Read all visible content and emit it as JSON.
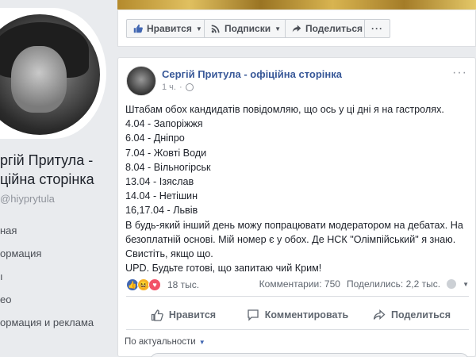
{
  "sidebar": {
    "page_name_line1": "ргій Притула -",
    "page_name_line2": "ційна сторінка",
    "handle": "hiyprytula",
    "nav_items": [
      "ная",
      "ормация",
      "ı",
      "ео",
      "ормация и реклама"
    ]
  },
  "actionbar": {
    "like_label": "Нравится",
    "follow_label": "Подписки",
    "share_label": "Поделиться",
    "more_label": "···"
  },
  "post": {
    "author": "Сергій Притула - офіційна сторінка",
    "time": "1 ч.",
    "more": "···",
    "body": "Штабам обох кандидатів повідомляю, що ось у ці дні я на гастролях.\n4.04 - Запоріжжя\n6.04 - Дніпро\n7.04 - Жовті Води\n8.04 - Вільногірськ\n13.04 - Ізяслав\n14.04 - Нетішин\n16,17.04 - Львів\nВ будь-який інший день можу попрацювати модератором на дебатах. На безоплатній основі. Мій номер є у обох. Де НСК \"Олімпійський\" я знаю. Свистіть, якщо що.\nUPD. Будьте готові, що запитаю чий Крим!",
    "reactions_count": "18 тыс.",
    "comments_count": "Комментарии: 750",
    "shares_count": "Поделились: 2,2 тыс.",
    "action_like": "Нравится",
    "action_comment": "Комментировать",
    "action_share": "Поделиться",
    "sort_label": "По актуальности"
  },
  "colors": {
    "link_blue": "#385898",
    "like_blue": "#4267b2",
    "love_red": "#f25268",
    "haha_yellow": "#f7b125"
  }
}
